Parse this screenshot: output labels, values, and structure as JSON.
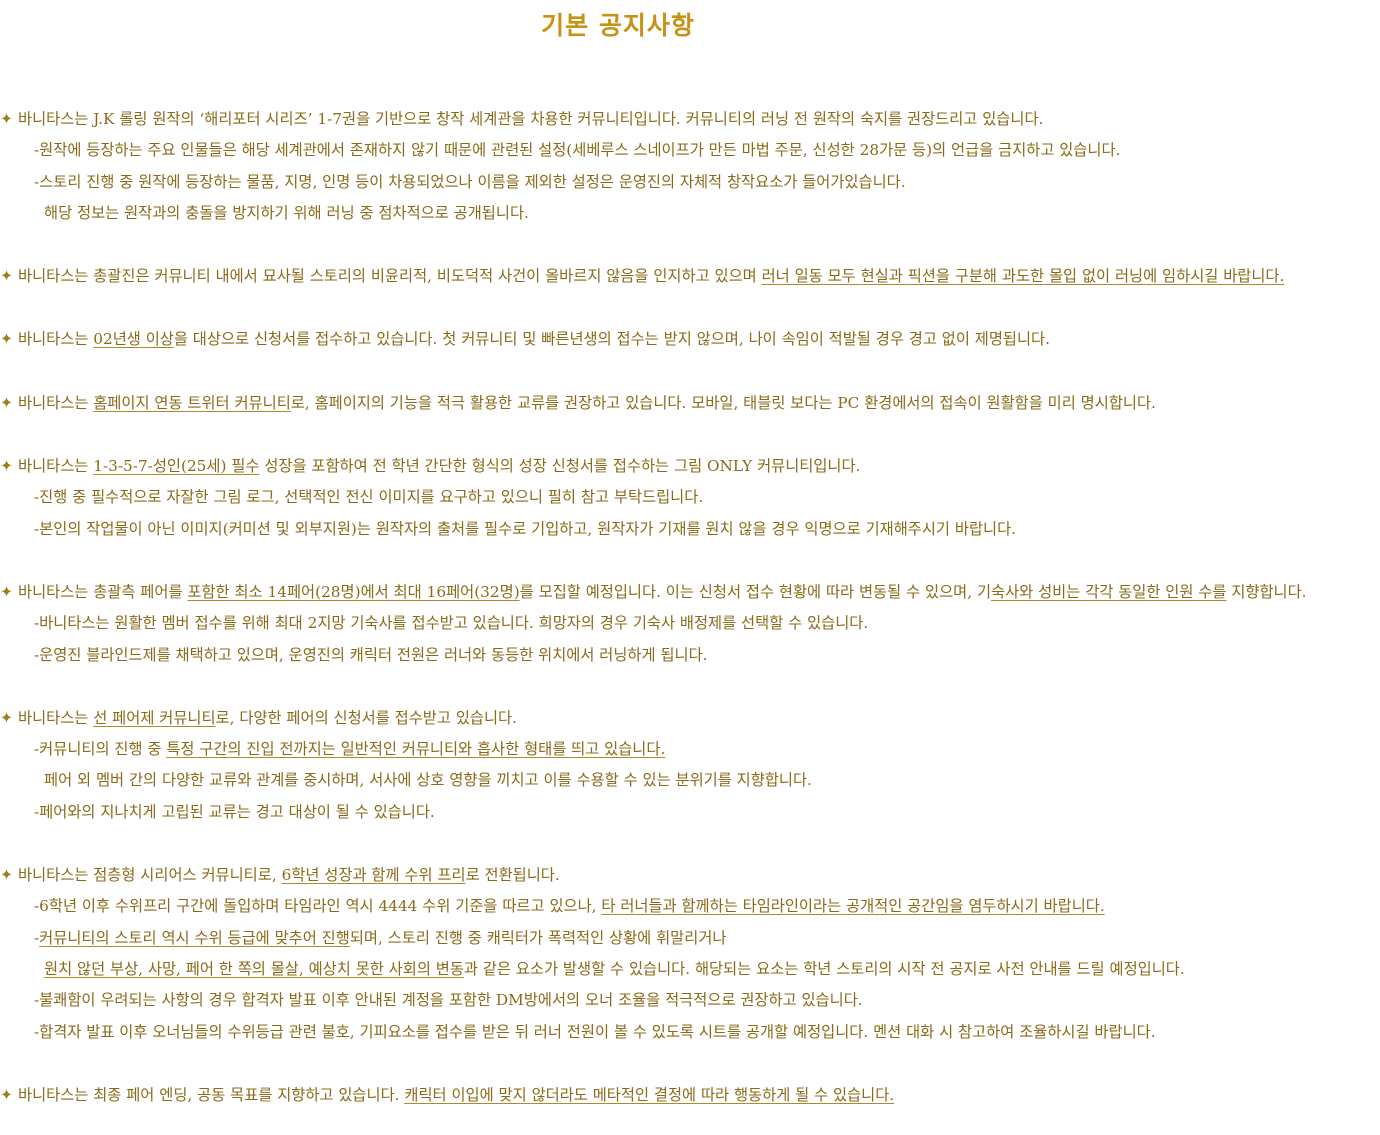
{
  "title": "기본 공지사항",
  "bullet_icon": "✦",
  "sections": [
    {
      "main": [
        {
          "t": "바니타스는 J.K 롤링 원작의 ‘해리포터 시리즈’ 1-7권을 기반으로 창작 세계관을 차용한 커뮤니티입니다. 커뮤니티의 러닝 전 원작의 숙지를 권장드리고 있습니다."
        }
      ],
      "subs": [
        {
          "type": "sub",
          "parts": [
            {
              "t": "-원작에 등장하는 주요 인물들은 해당 세계관에서 존재하지 않기 때문에 관련된 설정(세베루스 스네이프가 만든 마법 주문, 신성한 28가문 등)의 언급을 금지하고 있습니다."
            }
          ]
        },
        {
          "type": "sub",
          "parts": [
            {
              "t": "-스토리 진행 중 원작에 등장하는 물품, 지명, 인명 등이 차용되었으나 이름을 제외한 설정은 운영진의 자체적 창작요소가 들어가있습니다."
            }
          ]
        },
        {
          "type": "cont",
          "parts": [
            {
              "t": "해당 정보는 원작과의 충돌을 방지하기 위해 러닝 중 점차적으로 공개됩니다."
            }
          ]
        }
      ]
    },
    {
      "main": [
        {
          "t": "바니타스는 총괄진은 커뮤니티 내에서 묘사될 스토리의 비윤리적, 비도덕적 사건이 올바르지 않음을 인지하고 있으며 "
        },
        {
          "t": "러너 일동 모두 현실과 픽션을 구분해 과도한 몰입 없이 러닝에 임하시길 바랍니다.",
          "u": true
        }
      ],
      "subs": []
    },
    {
      "main": [
        {
          "t": "바니타스는 "
        },
        {
          "t": "02년생 이상",
          "u": true
        },
        {
          "t": "을 대상으로 신청서를 접수하고 있습니다. 첫 커뮤니티 및 빠른년생의 접수는 받지 않으며, 나이 속임이 적발될 경우 경고 없이 제명됩니다."
        }
      ],
      "subs": []
    },
    {
      "main": [
        {
          "t": "바니타스는 "
        },
        {
          "t": "홈페이지 연동 트위터 커뮤니티",
          "u": true
        },
        {
          "t": "로, 홈페이지의 기능을 적극 활용한 교류를 권장하고 있습니다. 모바일, 태블릿 보다는 PC 환경에서의 접속이 원활함을 미리 명시합니다."
        }
      ],
      "subs": []
    },
    {
      "main": [
        {
          "t": "바니타스는 "
        },
        {
          "t": "1-3-5-7-성인(25세) 필수",
          "u": true
        },
        {
          "t": " 성장을 포함하여 전 학년 간단한 형식의 성장 신청서를 접수하는 그림 ONLY 커뮤니티입니다."
        }
      ],
      "subs": [
        {
          "type": "sub",
          "parts": [
            {
              "t": "-진행 중 필수적으로 자잘한 그림 로그, 선택적인 전신 이미지를 요구하고 있으니 필히 참고 부탁드립니다."
            }
          ]
        },
        {
          "type": "sub",
          "parts": [
            {
              "t": "-본인의 작업물이 아닌 이미지(커미션 및 외부지원)는 원작자의 출처를 필수로 기입하고, 원작자가 기재를 원치 않을 경우 익명으로 기재해주시기 바랍니다."
            }
          ]
        }
      ]
    },
    {
      "main": [
        {
          "t": "바니타스는 총괄측 페어를 "
        },
        {
          "t": "포함한 최소 14페어(28명)에서 최대 16페어(32명)",
          "u": true
        },
        {
          "t": "를 모집할 예정입니다. 이는 신청서 접수 현황에 따라 변동될 수 있으며, 기"
        },
        {
          "t": "숙사와 성비는 각각 동일한 인원 수를",
          "u": true
        },
        {
          "t": " 지향합니다."
        }
      ],
      "subs": [
        {
          "type": "sub",
          "parts": [
            {
              "t": "-바니타스는 원활한 멤버 접수를 위해 최대 2지망 기숙사를 접수받고 있습니다. 희망자의 경우 기숙사 배정제를 선택할 수 있습니다."
            }
          ]
        },
        {
          "type": "sub",
          "parts": [
            {
              "t": "-운영진 블라인드제를 채택하고 있으며, 운영진의 캐릭터 전원은 러너와 동등한 위치에서 러닝하게 됩니다."
            }
          ]
        }
      ]
    },
    {
      "main": [
        {
          "t": "바니타스는 "
        },
        {
          "t": "선 페어제 커뮤니티",
          "u": true
        },
        {
          "t": "로, 다양한 페어의 신청서를 접수받고 있습니다."
        }
      ],
      "subs": [
        {
          "type": "sub",
          "parts": [
            {
              "t": "-커뮤니티의 진행 중 "
            },
            {
              "t": "특정 구간의 진입 전까지는 일반적인 커뮤니티와 흡사한 형태를 띄고 있습니다.",
              "u": true
            }
          ]
        },
        {
          "type": "cont",
          "parts": [
            {
              "t": "페어 외 멤버 간의 다양한 교류와 관계를 중시하며, 서사에 상호 영향을 끼치고 이를 수용할 수 있는 분위기를 지향합니다."
            }
          ]
        },
        {
          "type": "sub",
          "parts": [
            {
              "t": "-페어와의 지나치게 고립된 교류는 경고 대상이 될 수 있습니다."
            }
          ]
        }
      ]
    },
    {
      "main": [
        {
          "t": "바니타스는 점층형 시리어스 커뮤니티로, "
        },
        {
          "t": "6학년 성장과 함께 수위 프리",
          "u": true
        },
        {
          "t": "로 전환됩니다."
        }
      ],
      "subs": [
        {
          "type": "sub",
          "parts": [
            {
              "t": "-6학년 이후 수위프리 구간에 돌입하며 타임라인 역시 4444 수위 기준을 따르고 있으나, "
            },
            {
              "t": "타 러너들과 함께하는 타임라인이라는 공개적인 공간임을 염두하시기 바랍니다.",
              "u": true
            }
          ]
        },
        {
          "type": "sub",
          "parts": [
            {
              "t": "-"
            },
            {
              "t": "커뮤니티의 스토리 역시 수위 등급에 맞추어 진행",
              "u": true
            },
            {
              "t": "되며, 스토리 진행 중 캐릭터가 폭력적인 상황에 휘말리거나"
            }
          ]
        },
        {
          "type": "cont",
          "parts": [
            {
              "t": "원치 않던 부상, 사망, 페어 한 쪽의 몰살, 예상치 못한 사회의 변동",
              "u": true
            },
            {
              "t": "과 같은 요소가 발생할 수 있습니다. 해당되는 요소는 학년 스토리의 시작 전 공지로 사전 안내를 드릴 예정입니다."
            }
          ]
        },
        {
          "type": "sub",
          "parts": [
            {
              "t": "-불쾌함이 우려되는 사항의 경우 합격자 발표 이후 안내된 계정을 포함한 DM방에서의 오너 조율을 적극적으로 권장하고 있습니다."
            }
          ]
        },
        {
          "type": "sub",
          "parts": [
            {
              "t": "-합격자 발표 이후 오너님들의 수위등급 관련 불호, 기피요소를 접수를 받은 뒤 러너 전원이 볼 수 있도록 시트를 공개할 예정입니다. 멘션 대화 시 참고하여 조율하시길 바랍니다."
            }
          ]
        }
      ]
    },
    {
      "main": [
        {
          "t": "바니타스는 최종 페어 엔딩, 공동 목표를 지향하고 있습니다. "
        },
        {
          "t": "캐릭터 이입에 맞지 않더라도 메타적인 결정",
          "u": true
        },
        {
          "t": "에 따라 행동하게 될 수 있습니다.",
          "u": true
        }
      ],
      "subs": []
    }
  ]
}
